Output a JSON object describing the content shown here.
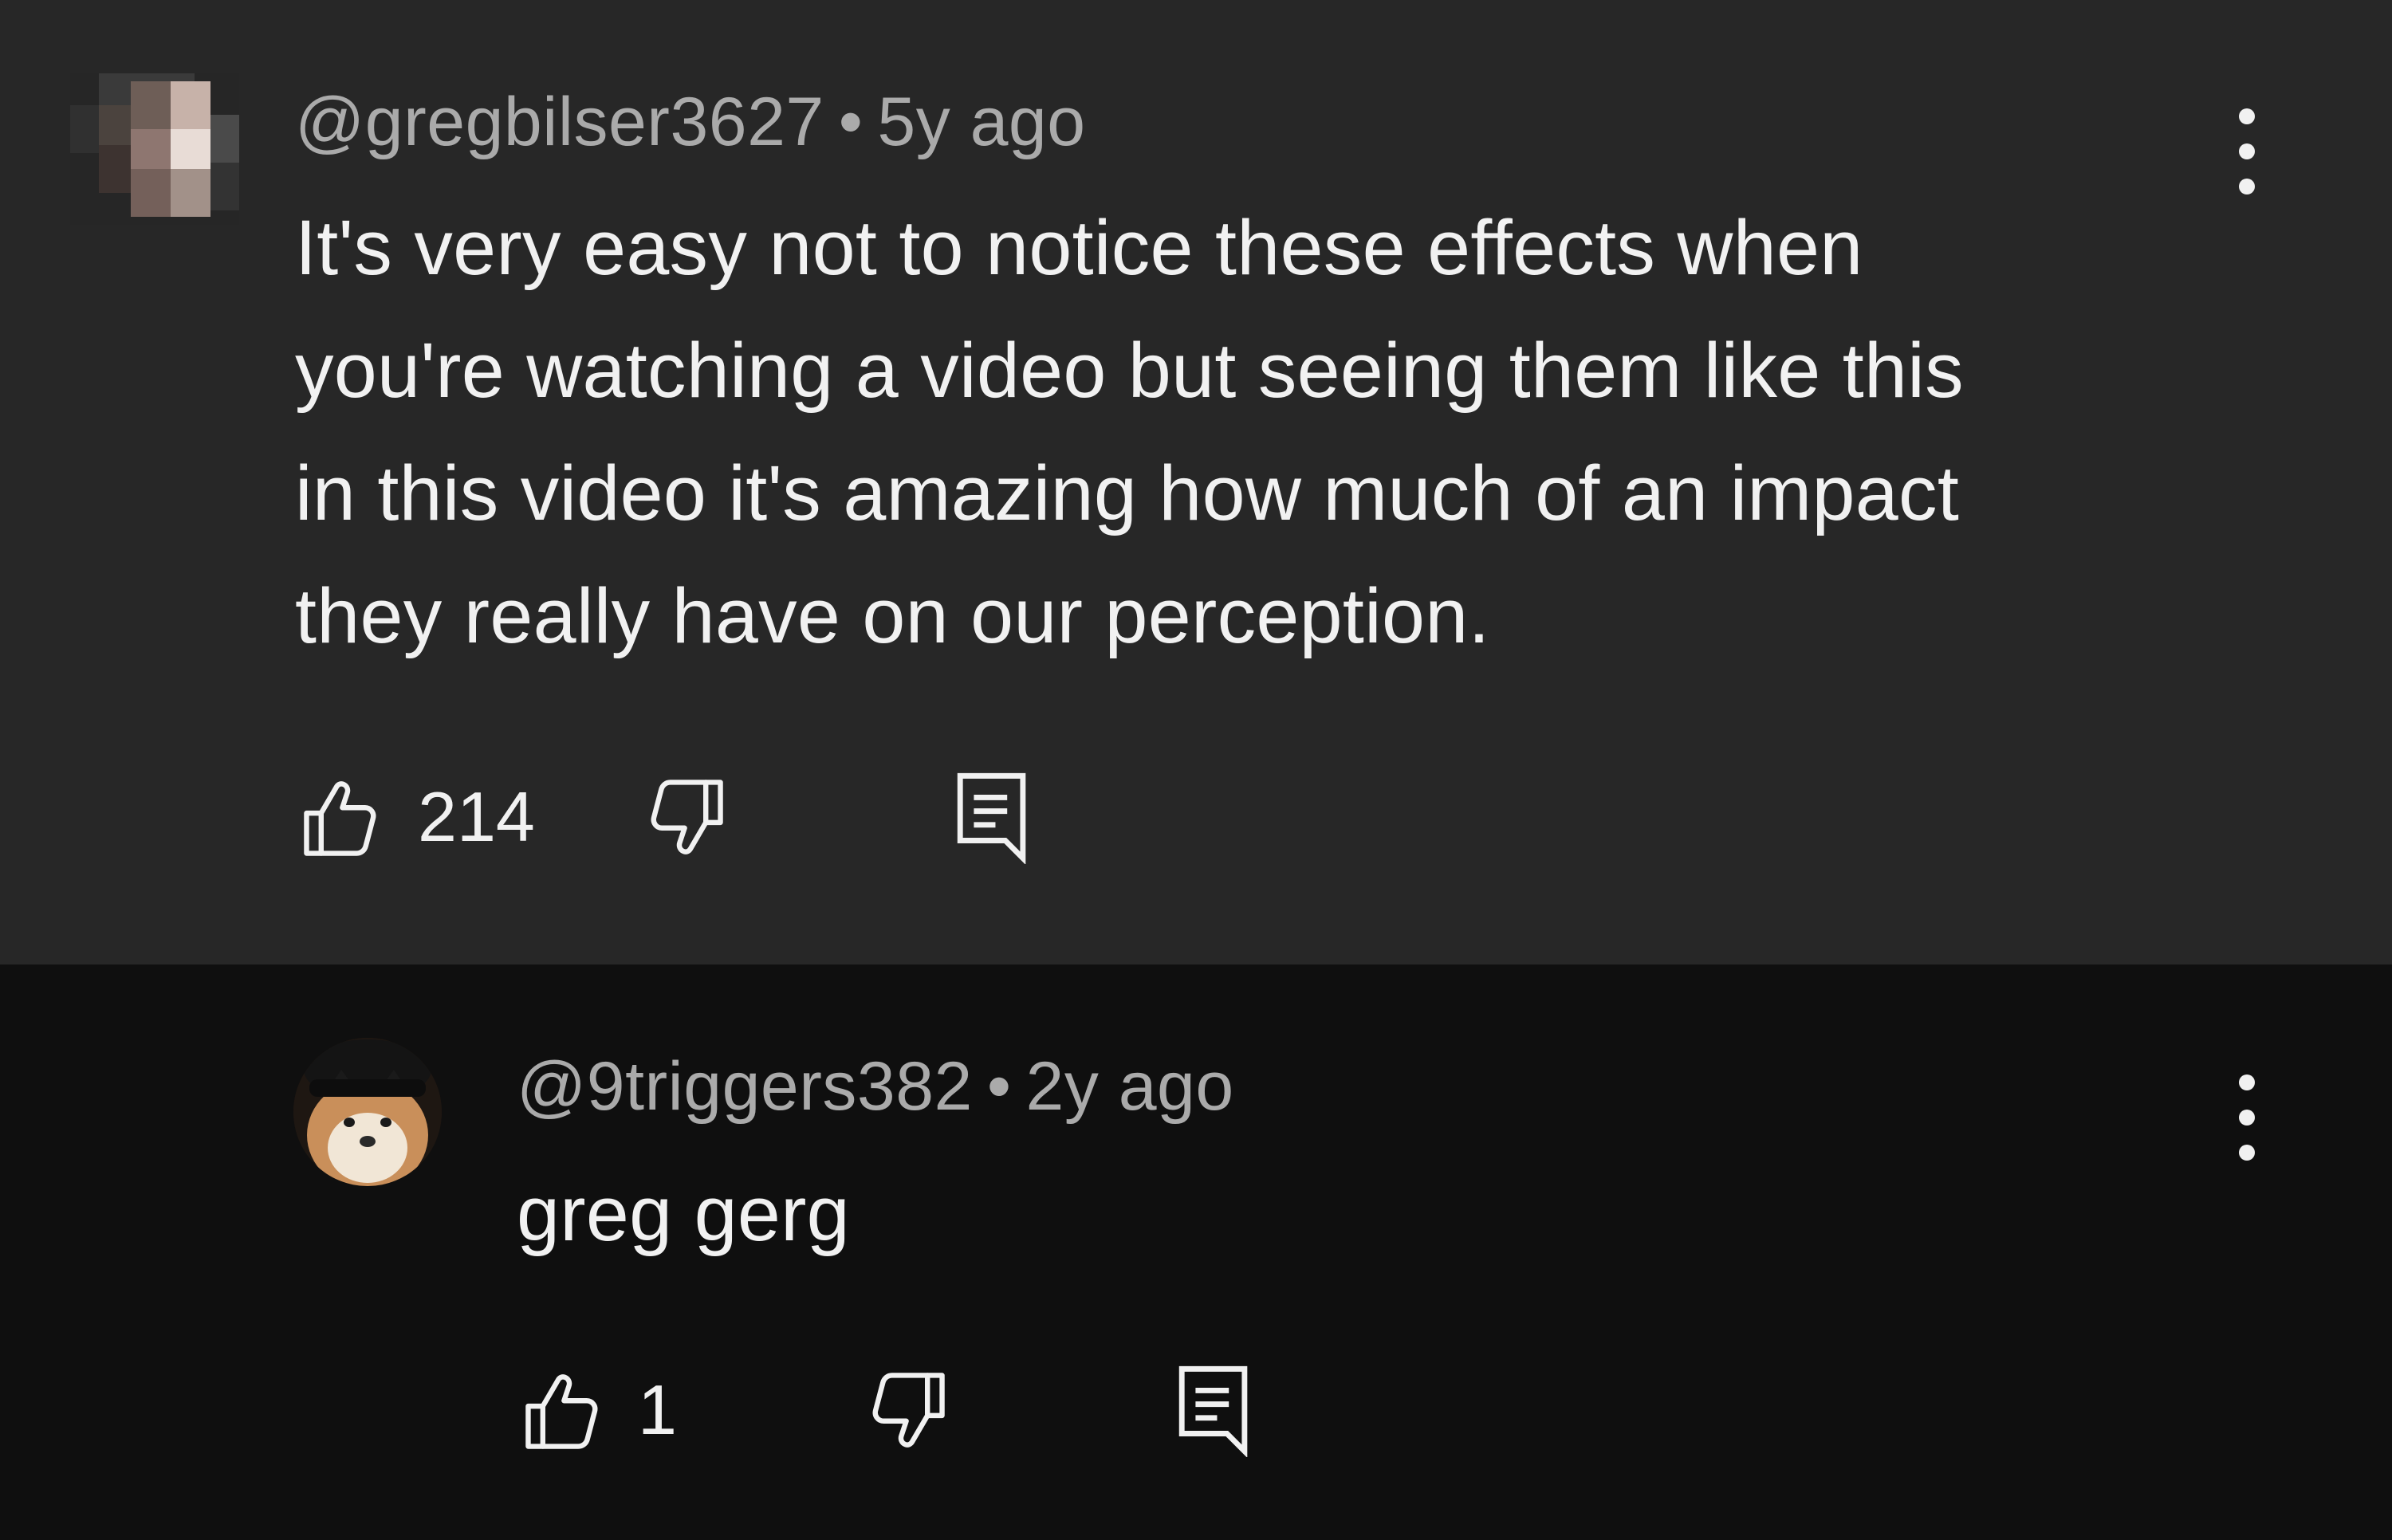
{
  "comments": [
    {
      "author": "@gregbilser3627",
      "separator": "•",
      "timestamp": "5y ago",
      "text_lines": [
        "It's very easy not to notice these effects when",
        "you're watching a video but seeing them like this",
        "in this video it's amazing how much of an impact",
        "they really have on our perception."
      ],
      "likes": "214"
    },
    {
      "author": "@9triggers382",
      "separator": "•",
      "timestamp": "2y ago",
      "text_lines": [
        "greg gerg"
      ],
      "likes": "1"
    }
  ],
  "icons": {
    "like": "thumbs-up-icon",
    "dislike": "thumbs-down-icon",
    "reply": "reply-icon",
    "more": "more-vertical-icon"
  },
  "colors": {
    "thread_bg": "#272727",
    "reply_bg": "#0f0f0f",
    "text_primary": "#f1f1f1",
    "text_secondary": "#aaaaaa"
  }
}
